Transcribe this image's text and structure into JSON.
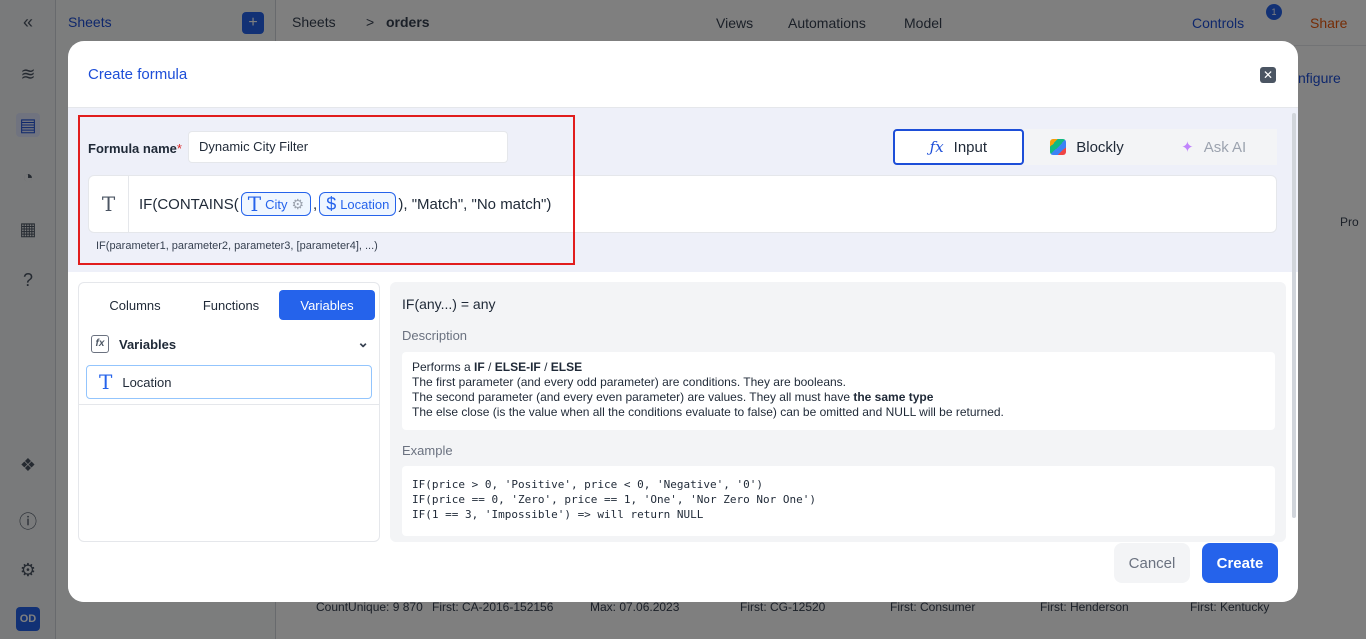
{
  "background": {
    "sidebar_panel_title": "Sheets",
    "breadcrumb_root": "Sheets",
    "breadcrumb_separator": ">",
    "breadcrumb_current": "orders",
    "nav_views": "Views",
    "nav_automations": "Automations",
    "nav_model": "Model",
    "controls_label": "Controls",
    "controls_badge": "1",
    "share_label": "Share",
    "configure_label": "nfigure",
    "column_header_partial": "Pro",
    "footer_stats": [
      "CountUnique: 9 870",
      "First: CA-2016-152156",
      "Max: 07.06.2023",
      "First: CG-12520",
      "First: Consumer",
      "First: Henderson",
      "First: Kentucky"
    ],
    "user_initials": "OD"
  },
  "modal": {
    "title": "Create formula",
    "formula_name_label": "Formula name",
    "required_mark": "*",
    "formula_name_value": "Dynamic City Filter",
    "modes": {
      "input": "Input",
      "blockly": "Blockly",
      "ask_ai": "Ask AI"
    },
    "expression": {
      "prefix": "IF(CONTAINS(",
      "chip1": "City",
      "separator": ",",
      "chip2": "Location",
      "suffix": "), \"Match\", \"No match\")"
    },
    "signature_hint": "IF(parameter1, parameter2, parameter3, [parameter4], ...)",
    "tabs": [
      "Columns",
      "Functions",
      "Variables"
    ],
    "variables_header": "Variables",
    "variables": [
      "Location"
    ],
    "doc": {
      "signature": "IF(any...) = any",
      "description_label": "Description",
      "description_intro": "Performs a",
      "kw_if": "IF",
      "slash1": "/",
      "kw_elseif": "ELSE-IF",
      "slash2": "/",
      "kw_else": "ELSE",
      "line2": "The first parameter (and every odd parameter) are conditions. They are booleans.",
      "line3_prefix": "The second parameter (and every even parameter) are values. They all must have",
      "line3_bold": "the same type",
      "line4": "The else close (is the value when all the conditions evaluate to false) can be omitted and NULL will be returned.",
      "example_label": "Example",
      "examples": [
        "IF(price > 0, 'Positive', price < 0, 'Negative', '0')",
        "IF(price == 0, 'Zero', price == 1, 'One', 'Nor Zero Nor One')",
        "IF(1 == 3, 'Impossible') => will return NULL"
      ]
    },
    "cancel_label": "Cancel",
    "create_label": "Create"
  },
  "colors": {
    "accent": "#2563eb",
    "highlight_border": "#e11d1d",
    "overlay": "rgba(0,0,0,0.5)"
  }
}
